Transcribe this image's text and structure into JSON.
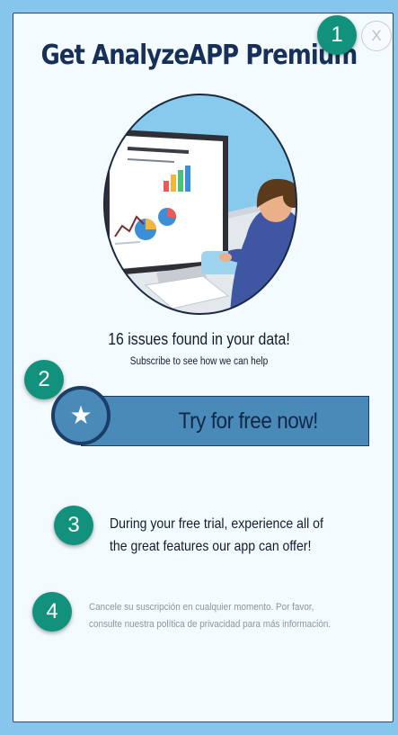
{
  "dialog": {
    "title": "Get AnalyzeAPP Premium",
    "close_label": "X",
    "issues_heading": "16 issues found in your data!",
    "issues_subtitle": "Subscribe to see how we can help",
    "cta": {
      "label": "Try for free now!",
      "star_glyph": "★"
    },
    "trial_lines": [
      "During your free trial, experience all of",
      "the great features our app can offer!"
    ],
    "disclaimer_lines": [
      "Cancele su suscripción en cualquier momento. Por favor,",
      "consulte nuestra política de privacidad para más información."
    ]
  },
  "step_markers": [
    "1",
    "2",
    "3",
    "4"
  ],
  "colors": {
    "page_background": "#86c5ec",
    "card_background": "#f3fbff",
    "title_text": "#17305a",
    "cta_fill": "#4a8ab9",
    "cta_border": "#1b3e68",
    "step_marker": "#12927c",
    "disclaimer_text": "#8c959b"
  },
  "icons": {
    "close": "close-icon",
    "cta": "star-icon",
    "illustration": "analytics-illustration"
  }
}
